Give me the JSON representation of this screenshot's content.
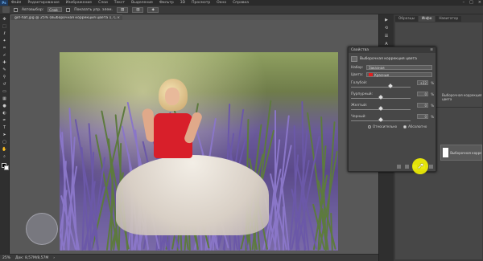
{
  "menubar": {
    "items": [
      "Файл",
      "Редактирование",
      "Изображение",
      "Слои",
      "Текст",
      "Выделение",
      "Фильтр",
      "3D",
      "Просмотр",
      "Окно",
      "Справка"
    ],
    "logo": "Ps"
  },
  "options": {
    "autoselect_label": "Автовыбор:",
    "autoselect_value": "Слой",
    "transform_label": "Показать упр. элем."
  },
  "document_tab": {
    "title": "girl-hat.jpg @ 25% (Выборочная коррекция цвета 1, Слой-маска/8) *",
    "close": "×"
  },
  "status": {
    "zoom": "25%",
    "doc": "Док: 8,57M/8,57M"
  },
  "properties": {
    "panel_title": "Свойства",
    "adjustment_title": "Выборочная коррекция цвета",
    "preset_label": "Набор:",
    "preset_value": "Заказная",
    "colors_label": "Цвета:",
    "colors_value": "Красные",
    "sliders": [
      {
        "label": "Голубой:",
        "value": "+32",
        "pct": "%",
        "level": 0.66
      },
      {
        "label": "Пурпурный:",
        "value": "0",
        "pct": "%",
        "level": 0.5
      },
      {
        "label": "Желтый:",
        "value": "0",
        "pct": "%",
        "level": 0.5
      },
      {
        "label": "Черный:",
        "value": "0",
        "pct": "%",
        "level": 0.5
      }
    ],
    "method_relative": "Относительно",
    "method_absolute": "Абсолютно",
    "method_selected": "absolute"
  },
  "right_panel": {
    "tabs": [
      "Образцы",
      "Инфо",
      "Навигатор"
    ],
    "active_tab": "Инфо",
    "layer_name": "Выборочная коррекция...",
    "info_text": "Выборочная коррекция цвета"
  },
  "colors": {
    "accent": "#d81f2a",
    "cursor": "#ffff00"
  }
}
